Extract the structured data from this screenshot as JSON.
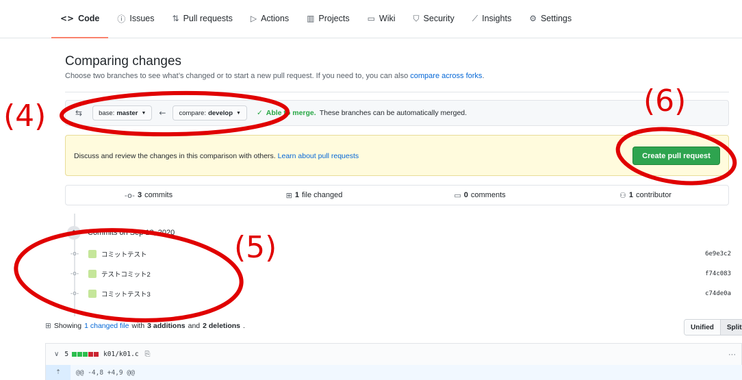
{
  "nav": {
    "tabs": [
      {
        "label": "Code",
        "icon": "<>",
        "active": true
      },
      {
        "label": "Issues",
        "icon": "ⓘ"
      },
      {
        "label": "Pull requests",
        "icon": "⇅"
      },
      {
        "label": "Actions",
        "icon": "▷"
      },
      {
        "label": "Projects",
        "icon": "▥"
      },
      {
        "label": "Wiki",
        "icon": "▭"
      },
      {
        "label": "Security",
        "icon": "⛉"
      },
      {
        "label": "Insights",
        "icon": "⟋"
      },
      {
        "label": "Settings",
        "icon": "⚙"
      }
    ]
  },
  "header": {
    "title": "Comparing changes",
    "desc": "Choose two branches to see what’s changed or to start a new pull request. If you need to, you can also ",
    "desc_link": "compare across forks",
    "desc_end": "."
  },
  "range": {
    "base_label": "base:",
    "base_value": "master",
    "compare_label": "compare:",
    "compare_value": "develop",
    "merge_ok": "Able to merge.",
    "merge_text": "These branches can be automatically merged."
  },
  "flash": {
    "text": "Discuss and review the changes in this comparison with others. ",
    "link": "Learn about pull requests",
    "button": "Create pull request"
  },
  "summary": {
    "commits_count": "3",
    "commits_label": "commits",
    "files_count": "1",
    "files_label": "file changed",
    "comments_count": "0",
    "comments_label": "comments",
    "contributors_count": "1",
    "contributors_label": "contributor"
  },
  "commits": {
    "heading": "Commits on Sep 18, 2020",
    "items": [
      {
        "message": "コミットテスト",
        "sha": "6e9e3c2"
      },
      {
        "message": "テストコミット2",
        "sha": "f74c083"
      },
      {
        "message": "コミットテスト3",
        "sha": "c74de0a"
      }
    ]
  },
  "files": {
    "showing": "Showing",
    "changed_link": "1 changed file",
    "with": "with",
    "additions": "3 additions",
    "and": "and",
    "deletions": "2 deletions",
    "end": ".",
    "unified": "Unified",
    "split": "Split",
    "file_count": "5",
    "file_path": "k01/k01.c",
    "more": "···",
    "hunk": "@@ -4,8 +4,9 @@"
  },
  "annotations": {
    "label_4": "(4)",
    "label_5": "(5)",
    "label_6": "(6)",
    "color": "#e00000"
  },
  "colors": {
    "accent": "#0366d6",
    "green": "#2ea44f",
    "tab_underline": "#f9826c"
  }
}
